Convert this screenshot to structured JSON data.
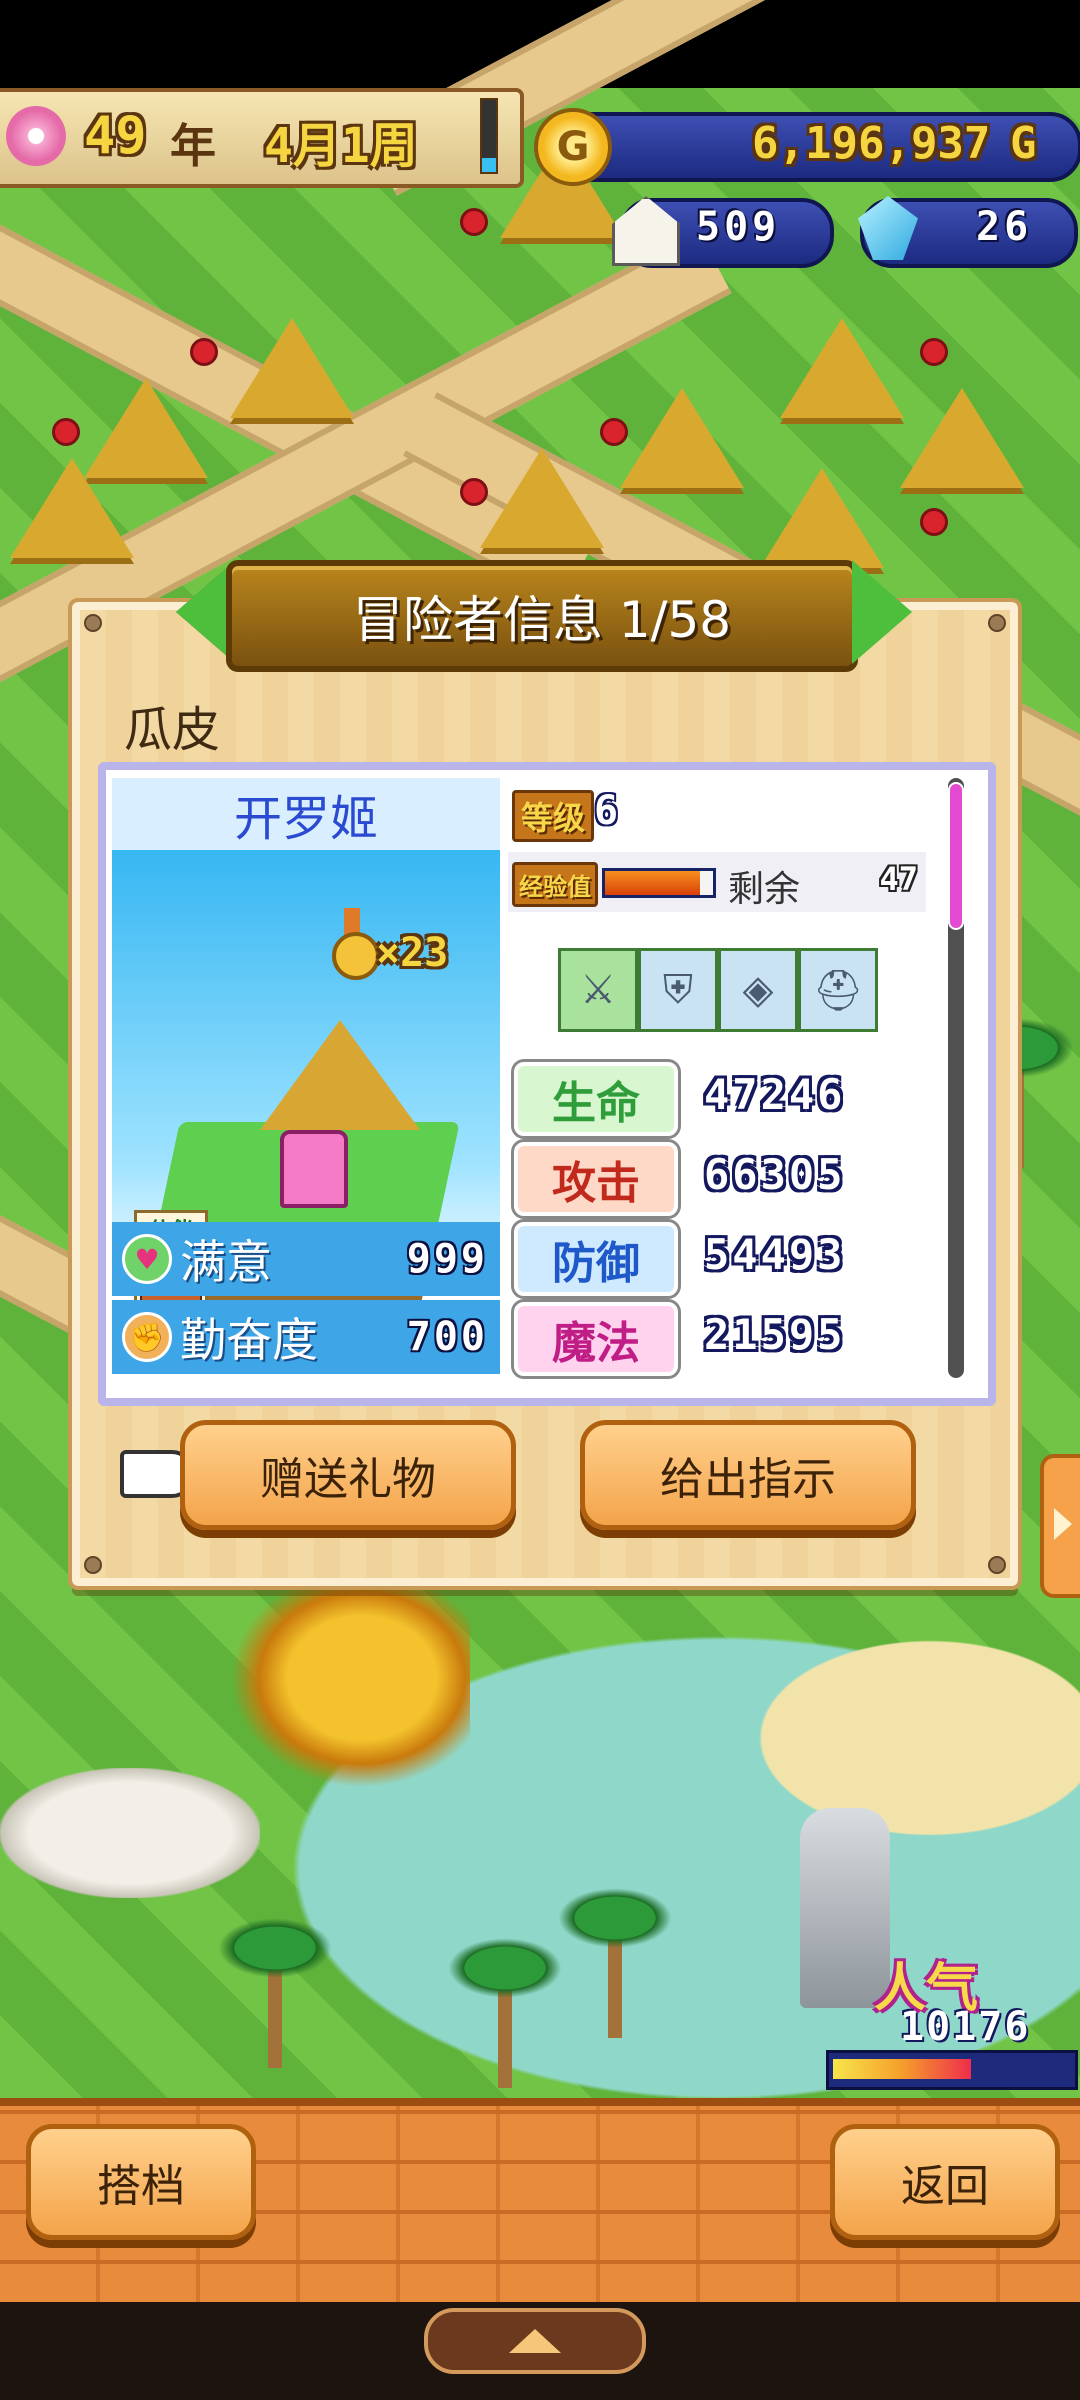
{
  "top_bar": {
    "year_number": "49",
    "year_suffix": "年",
    "month_week": "4月1周",
    "gold": "6,196,937",
    "gold_unit": "G",
    "population": "509",
    "crystals": "26"
  },
  "dialog": {
    "title": "冒险者信息 1/58",
    "adventurer_name": "瓜皮",
    "job": "开罗姬",
    "medal_count": "×23",
    "partner_label": "伙伴",
    "level_label": "等级",
    "level_value": "6",
    "exp_label": "经验值",
    "exp_progress": 0.88,
    "exp_remaining_label": "剩余",
    "exp_remaining_value": "47",
    "equipment": [
      "sword",
      "armor",
      "shield",
      "helmet"
    ],
    "status": [
      {
        "label": "满意",
        "value": "999",
        "icon": "heart-icon"
      },
      {
        "label": "勤奋度",
        "value": "700",
        "icon": "fist-icon"
      }
    ],
    "attributes": [
      {
        "label": "生命",
        "value": "47246",
        "color": "#2f9e3a",
        "bg": "#d8f6cf"
      },
      {
        "label": "攻击",
        "value": "66305",
        "color": "#c0291c",
        "bg": "#ffd9c7"
      },
      {
        "label": "防御",
        "value": "54493",
        "color": "#1e58c9",
        "bg": "#cfeaff"
      },
      {
        "label": "魔法",
        "value": "21595",
        "color": "#c01e86",
        "bg": "#ffd3ee"
      }
    ],
    "buttons": {
      "gift": "赠送礼物",
      "instruct": "给出指示"
    }
  },
  "popularity": {
    "label": "人气",
    "value": "10176",
    "level": 0.6
  },
  "bottom": {
    "partner_button": "搭档",
    "back_button": "返回"
  },
  "colors": {
    "banner": "#8e6214",
    "panel_border": "#b9b4ea",
    "button": "#f4a44a"
  }
}
